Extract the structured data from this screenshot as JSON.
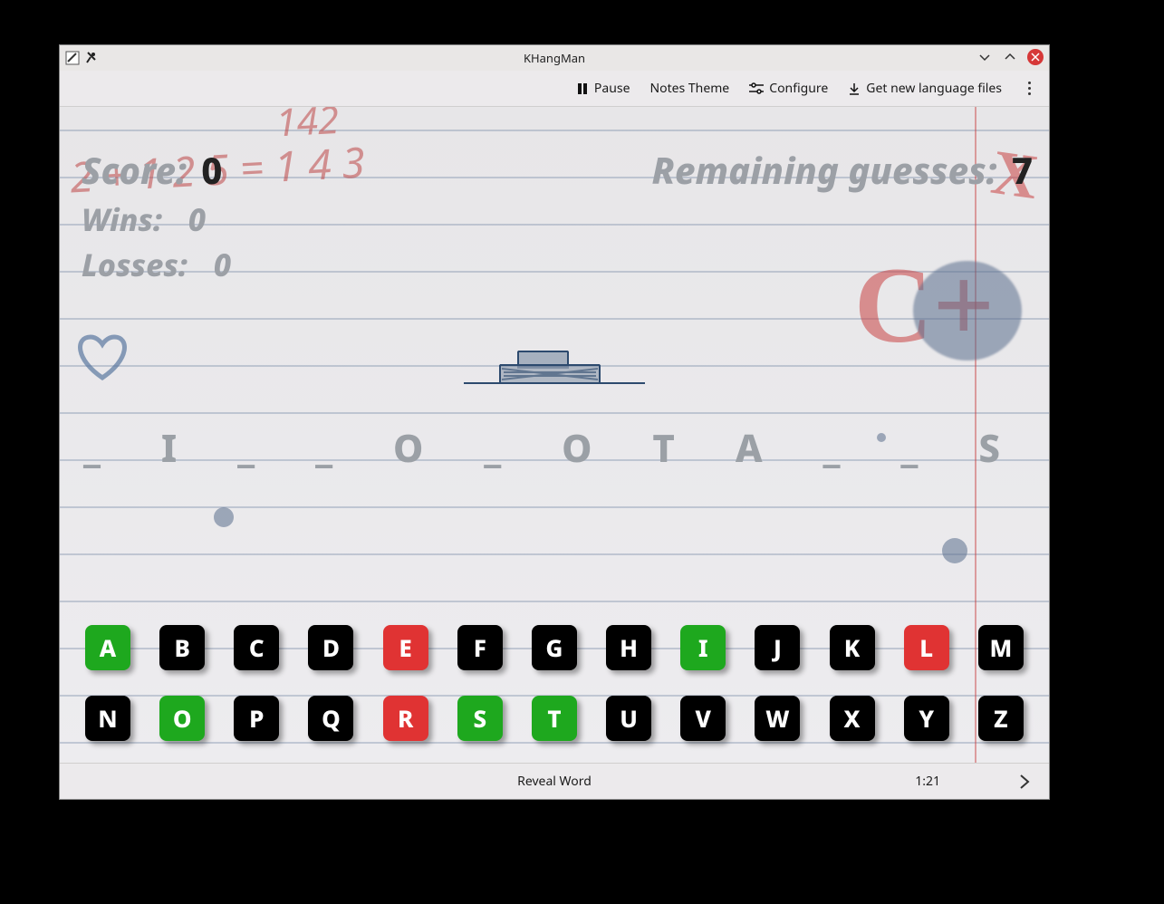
{
  "window": {
    "title": "KHangMan"
  },
  "toolbar": {
    "pause_label": "Pause",
    "theme_label": "Notes Theme",
    "configure_label": "Configure",
    "get_lang_label": "Get new language files"
  },
  "hud": {
    "score_label": "Score:",
    "score_value": "0",
    "wins_label": "Wins:",
    "wins_value": "0",
    "losses_label": "Losses:",
    "losses_value": "0",
    "remaining_label": "Remaining guesses:",
    "remaining_value": "7"
  },
  "word": "_ I _ _ O _ O T A _ _ S",
  "keys_row1": [
    {
      "l": "A",
      "s": "correct"
    },
    {
      "l": "B",
      "s": ""
    },
    {
      "l": "C",
      "s": ""
    },
    {
      "l": "D",
      "s": ""
    },
    {
      "l": "E",
      "s": "wrong"
    },
    {
      "l": "F",
      "s": ""
    },
    {
      "l": "G",
      "s": ""
    },
    {
      "l": "H",
      "s": ""
    },
    {
      "l": "I",
      "s": "correct"
    },
    {
      "l": "J",
      "s": ""
    },
    {
      "l": "K",
      "s": ""
    },
    {
      "l": "L",
      "s": "wrong"
    },
    {
      "l": "M",
      "s": ""
    }
  ],
  "keys_row2": [
    {
      "l": "N",
      "s": ""
    },
    {
      "l": "O",
      "s": "correct"
    },
    {
      "l": "P",
      "s": ""
    },
    {
      "l": "Q",
      "s": ""
    },
    {
      "l": "R",
      "s": "wrong"
    },
    {
      "l": "S",
      "s": "correct"
    },
    {
      "l": "T",
      "s": "correct"
    },
    {
      "l": "U",
      "s": ""
    },
    {
      "l": "V",
      "s": ""
    },
    {
      "l": "W",
      "s": ""
    },
    {
      "l": "X",
      "s": ""
    },
    {
      "l": "Y",
      "s": ""
    },
    {
      "l": "Z",
      "s": ""
    }
  ],
  "footer": {
    "reveal_label": "Reveal Word",
    "timer": "1:21"
  },
  "doodles": {
    "numbers_top": "142",
    "numbers_line": "2 + 1 2 5  =  1 4 3",
    "grade": "C+",
    "x": "X"
  }
}
